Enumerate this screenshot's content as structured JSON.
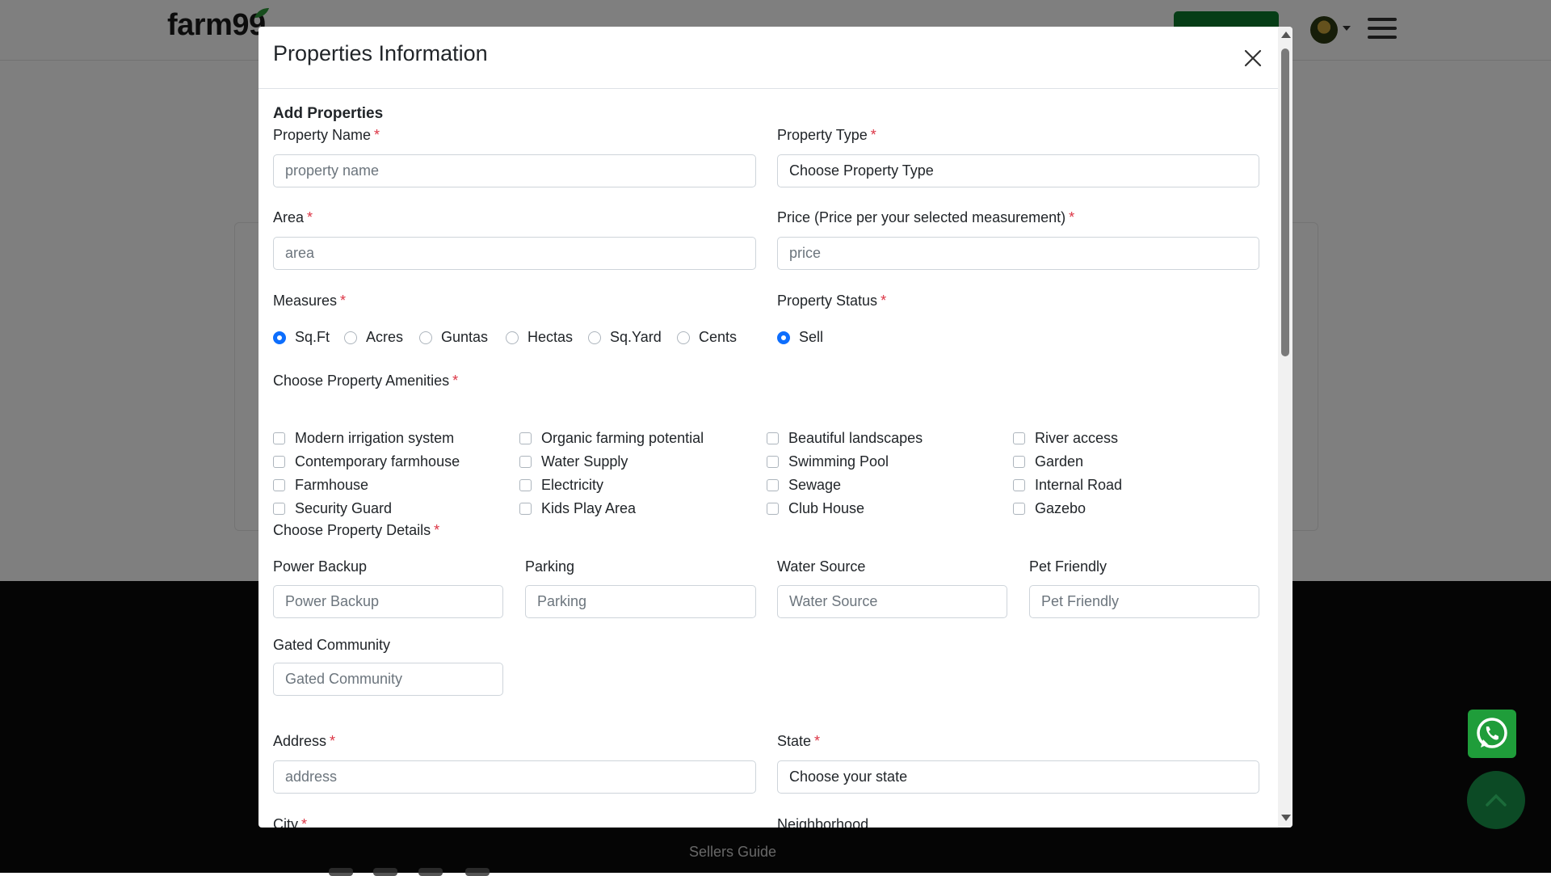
{
  "background": {
    "logo": "farm99",
    "footer_link": "Sellers Guide"
  },
  "modal": {
    "title": "Properties Information",
    "section_heading": "Add Properties",
    "property_name": {
      "label": "Property Name",
      "required": "*",
      "placeholder": "property name"
    },
    "property_type": {
      "label": "Property Type",
      "required": "*",
      "value": "Choose Property Type"
    },
    "area": {
      "label": "Area",
      "required": "*",
      "placeholder": "area"
    },
    "price": {
      "label": "Price (Price per your selected measurement)",
      "required": "*",
      "placeholder": "price"
    },
    "measures": {
      "label": "Measures",
      "required": "*",
      "options": [
        "Sq.Ft",
        "Acres",
        "Guntas",
        "Hectas",
        "Sq.Yard",
        "Cents"
      ],
      "selected": "Sq.Ft"
    },
    "property_status": {
      "label": "Property Status",
      "required": "*",
      "options": [
        "Sell"
      ],
      "selected": "Sell"
    },
    "amenities": {
      "label": "Choose Property Amenities",
      "required": "*",
      "columns": [
        [
          "Modern irrigation system",
          "Contemporary farmhouse",
          "Farmhouse",
          "Security Guard"
        ],
        [
          "Organic farming potential",
          "Water Supply",
          "Electricity",
          "Kids Play Area"
        ],
        [
          "Beautiful landscapes",
          "Swimming Pool",
          "Sewage",
          "Club House"
        ],
        [
          "River access",
          "Garden",
          "Internal Road",
          "Gazebo"
        ]
      ]
    },
    "details": {
      "label": "Choose Property Details",
      "required": "*",
      "fields": [
        {
          "label": "Power Backup",
          "placeholder": "Power Backup"
        },
        {
          "label": "Parking",
          "placeholder": "Parking"
        },
        {
          "label": "Water Source",
          "placeholder": "Water Source"
        },
        {
          "label": "Pet Friendly",
          "placeholder": "Pet Friendly"
        },
        {
          "label": "Gated Community",
          "placeholder": "Gated Community"
        }
      ]
    },
    "address": {
      "label": "Address",
      "required": "*",
      "placeholder": "address"
    },
    "state": {
      "label": "State",
      "required": "*",
      "value": "Choose your state"
    },
    "city": {
      "label": "City",
      "required": "*"
    },
    "neighborhood": {
      "label": "Neighborhood"
    }
  },
  "colors": {
    "accent": "#0d6efd",
    "required": "#dc3545",
    "whatsapp": "#1f9d3a",
    "scroll_top": "#0c4a25"
  }
}
